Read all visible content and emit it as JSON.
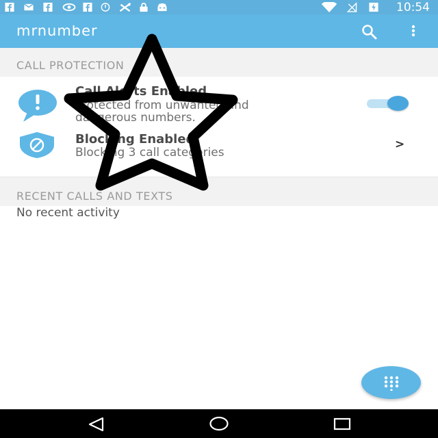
{
  "status_bar": {
    "time": "10:54",
    "icons": [
      "facebook-icon",
      "mail-icon",
      "facebook-icon",
      "eye-icon",
      "facebook-icon",
      "sync-icon",
      "no-signal-icon",
      "lock-icon",
      "android-icon",
      "wifi-icon",
      "no-sim-icon",
      "battery-charging-icon"
    ]
  },
  "app_bar": {
    "logo_text": "mrnumber",
    "actions": [
      "search-icon",
      "more-vert-icon"
    ],
    "color": "#5fb7e5"
  },
  "call_protection": {
    "header": "CALL PROTECTION",
    "rows": [
      {
        "title": "Call Alerts Enabled",
        "subtitle_line1": "Protected from unwanted and",
        "subtitle_line2": "dangerous numbers.",
        "icon": "alert-bubble-icon",
        "toggle_on": true
      },
      {
        "title": "Blocking Enabled",
        "subtitle": "Blocking 3 call categories",
        "icon": "shield-block-icon",
        "chevron": ">"
      }
    ]
  },
  "recent": {
    "header": "RECENT CALLS AND TEXTS",
    "empty_text": "No recent activity"
  },
  "fab": {
    "icon": "dialpad-icon"
  },
  "nav_bar": {
    "buttons": [
      "back-icon",
      "home-icon",
      "recents-icon"
    ]
  },
  "overlay": {
    "icon": "star-outline-icon"
  }
}
